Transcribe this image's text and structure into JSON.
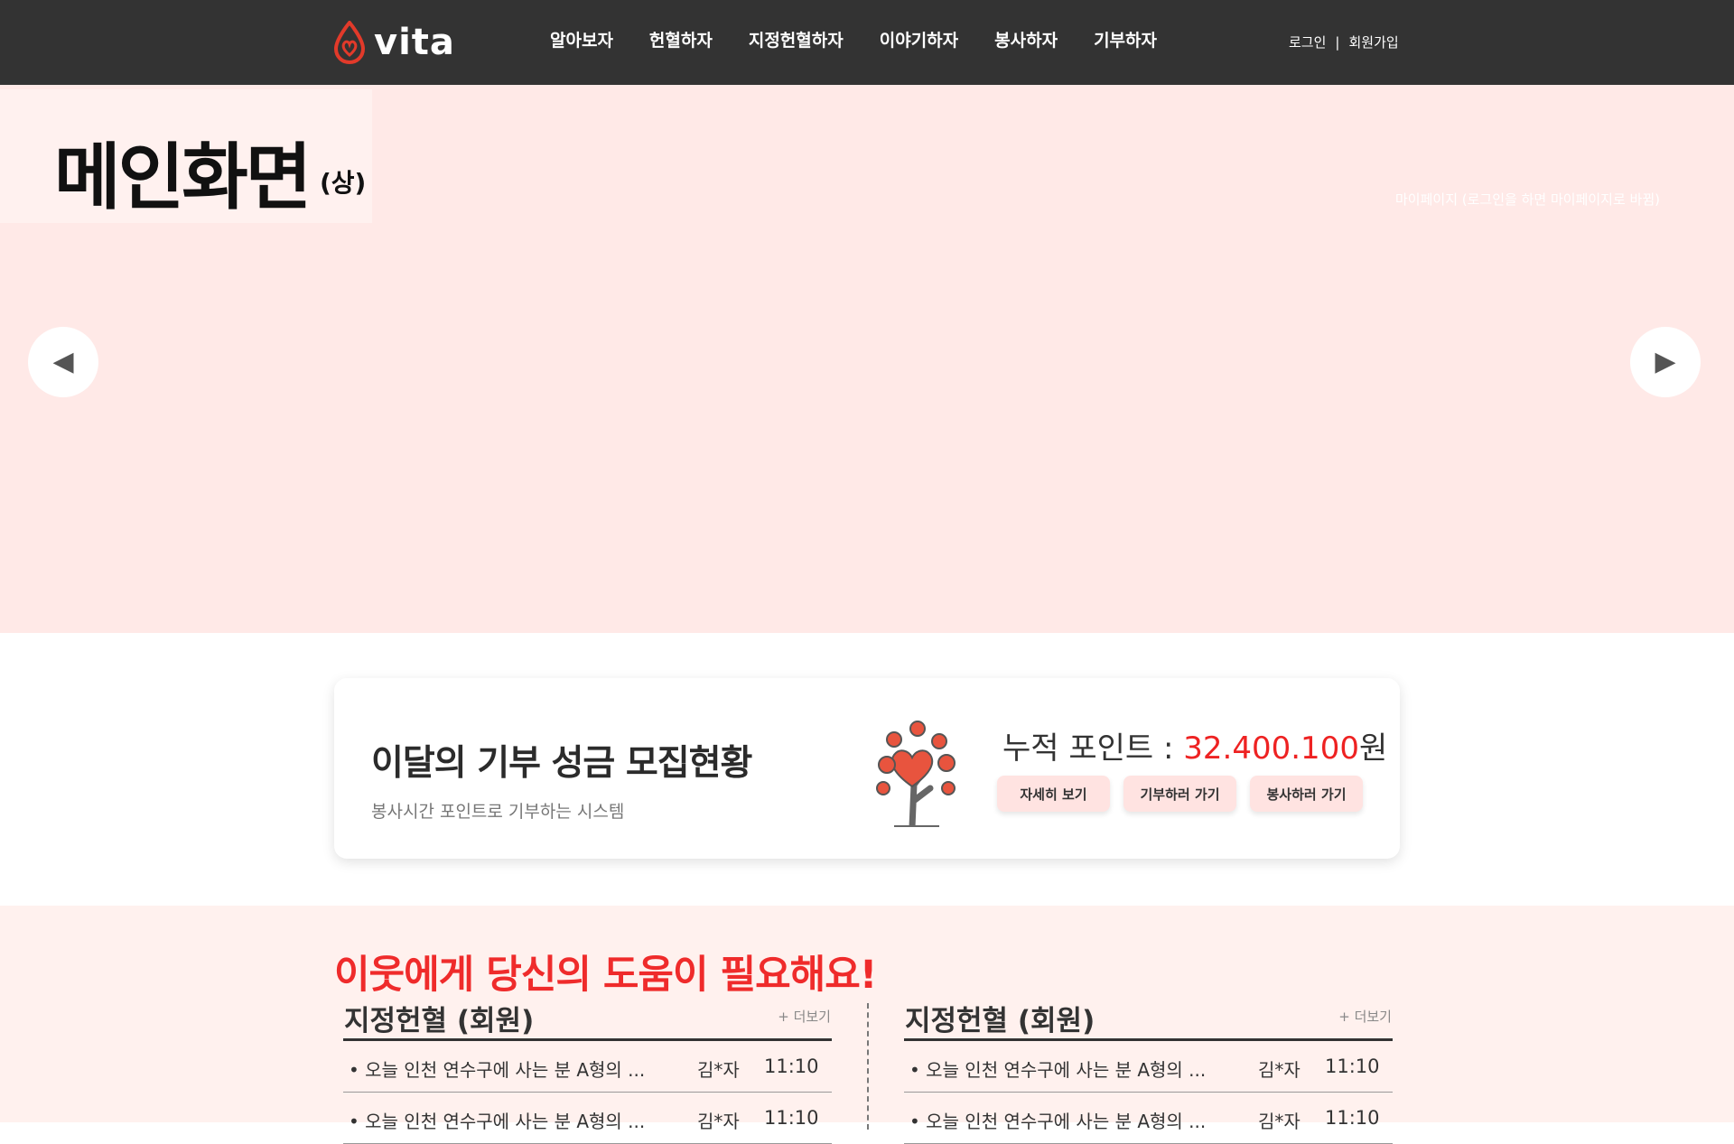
{
  "header": {
    "logo_text": "vita",
    "nav": [
      "알아보자",
      "헌혈하자",
      "지정헌혈하자",
      "이야기하자",
      "봉사하자",
      "기부하자"
    ],
    "login": "로그인",
    "separator": "|",
    "signup": "회원가입"
  },
  "hero": {
    "title": "메인화면",
    "title_suffix": "(상)",
    "note": "마이페이지 (로그인을 하면 마이페이지로 바뀜)",
    "prev_arrow": "◀",
    "next_arrow": "▶"
  },
  "donation": {
    "title": "이달의 기부 성금 모집현황",
    "subtitle": "봉사시간 포인트로 기부하는 시스템",
    "points_label": "누적 포인트 : ",
    "points_value": "32.400.100",
    "points_unit": "원",
    "buttons": [
      "자세히 보기",
      "기부하러 가기",
      "봉사하러 가기"
    ]
  },
  "help": {
    "title": "이웃에게 당신의 도움이 필요해요!",
    "panels": [
      {
        "title": "지정헌혈 (회원)",
        "more": "+ 더보기",
        "rows": [
          {
            "text": "• 오늘 인천 연수구에 사는 분 A형의 ...",
            "name": "김*자",
            "time": "11:10"
          },
          {
            "text": "• 오늘 인천 연수구에 사는 분 A형의 ...",
            "name": "김*자",
            "time": "11:10"
          }
        ]
      },
      {
        "title": "지정헌혈 (회원)",
        "more": "+ 더보기",
        "rows": [
          {
            "text": "• 오늘 인천 연수구에 사는 분 A형의 ...",
            "name": "김*자",
            "time": "11:10"
          },
          {
            "text": "• 오늘 인천 연수구에 사는 분 A형의 ...",
            "name": "김*자",
            "time": "11:10"
          }
        ]
      }
    ]
  },
  "colors": {
    "header_bg": "#333333",
    "hero_bg": "#ffe9e7",
    "accent_red": "#ee2222",
    "pill_bg": "#ffe3e1",
    "section_bg": "#fff1ee"
  }
}
